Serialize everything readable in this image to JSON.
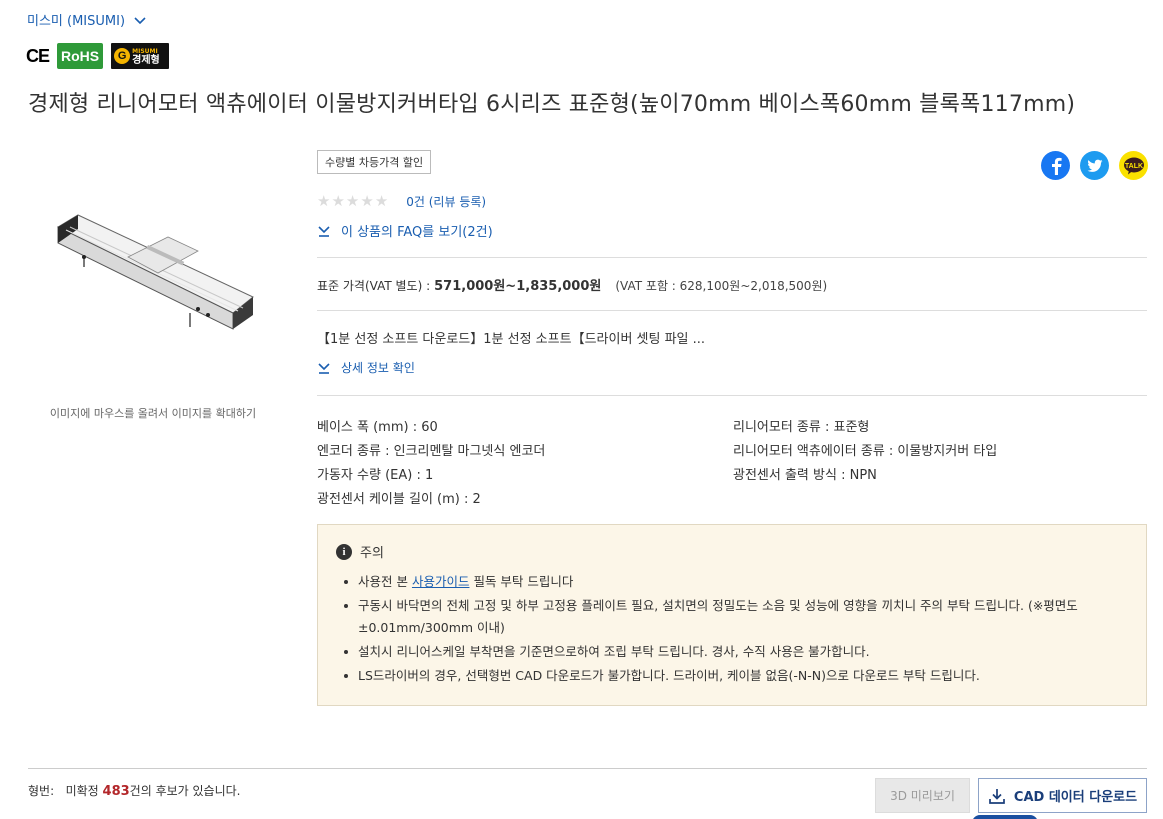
{
  "brand": {
    "label": "미스미 (MISUMI)"
  },
  "badges": {
    "ce": "CE",
    "rohs": "RoHS",
    "economy_small": "MISUMI",
    "economy_main": "경제형"
  },
  "product": {
    "title": "경제형 리니어모터 액츄에이터 이물방지커버타입 6시리즈 표준형(높이70mm 베이스폭60mm 블록폭117mm)",
    "image_caption": "이미지에 마우스를 올려서 이미지를 확대하기"
  },
  "tags": {
    "discount": "수량별 차등가격 할인"
  },
  "reviews": {
    "rating": 0,
    "max": 5,
    "link": "0건 (리뷰 등록)"
  },
  "faq": {
    "link": "이 상품의 FAQ를 보기(2건)"
  },
  "price": {
    "label": "표준 가격(VAT 별도) :",
    "range": "571,000원~1,835,000원",
    "vat_included": "(VAT 포함 : 628,100원~2,018,500원)"
  },
  "description": {
    "snippet": "【1분 선정 소프트 다운로드】1분 선정 소프트【드라이버 셋팅 파일 ...",
    "detail_link": "상세 정보 확인"
  },
  "specs": {
    "base_width": "베이스 폭 (mm) : 60",
    "encoder": "엔코더 종류 : 인크리멘탈 마그넷식 엔코더",
    "movers": "가동자 수량 (EA) : 1",
    "cable_length": "광전센서 케이블 길이 (m) : 2",
    "motor_type": "리니어모터 종류 : 표준형",
    "actuator_type": "리니어모터 액츄에이터 종류 : 이물방지커버 타입",
    "sensor_output": "광전센서 출력 방식 : NPN"
  },
  "notice": {
    "heading": "주의",
    "item1_prefix": "사용전 본 ",
    "item1_link": "사용가이드",
    "item1_suffix": " 필독 부탁 드립니다",
    "item2": "구동시 바닥면의 전체 고정 및 하부 고정용 플레이트 필요, 설치면의 정밀도는 소음 및 성능에 영향을 끼치니 주의 부탁 드립니다. (※평면도 ±0.01mm/300mm 이내)",
    "item3": "설치시 리니어스케일 부착면을 기준면으로하여 조립 부탁 드립니다. 경사, 수직 사용은 불가합니다.",
    "item4": "LS드라이버의 경우, 선택형번 CAD 다운로드가 불가합니다. 드라이버, 케이블 없음(-N-N)으로 다운로드 부탁 드립니다."
  },
  "model": {
    "label": "형번:",
    "prefix": "미확정",
    "count": "483",
    "suffix": "건의 후보가 있습니다."
  },
  "buttons": {
    "preview3d": "3D 미리보기",
    "cad_download": "CAD 데이터 다운로드"
  },
  "social": {
    "icons": [
      "facebook-icon",
      "twitter-icon",
      "kakaotalk-icon"
    ],
    "kakao_text": "TALK"
  },
  "colors": {
    "link": "#1a5eb0",
    "notice_bg": "#fcf6e8",
    "count": "#b3272a",
    "rohs": "#2f9a39"
  }
}
